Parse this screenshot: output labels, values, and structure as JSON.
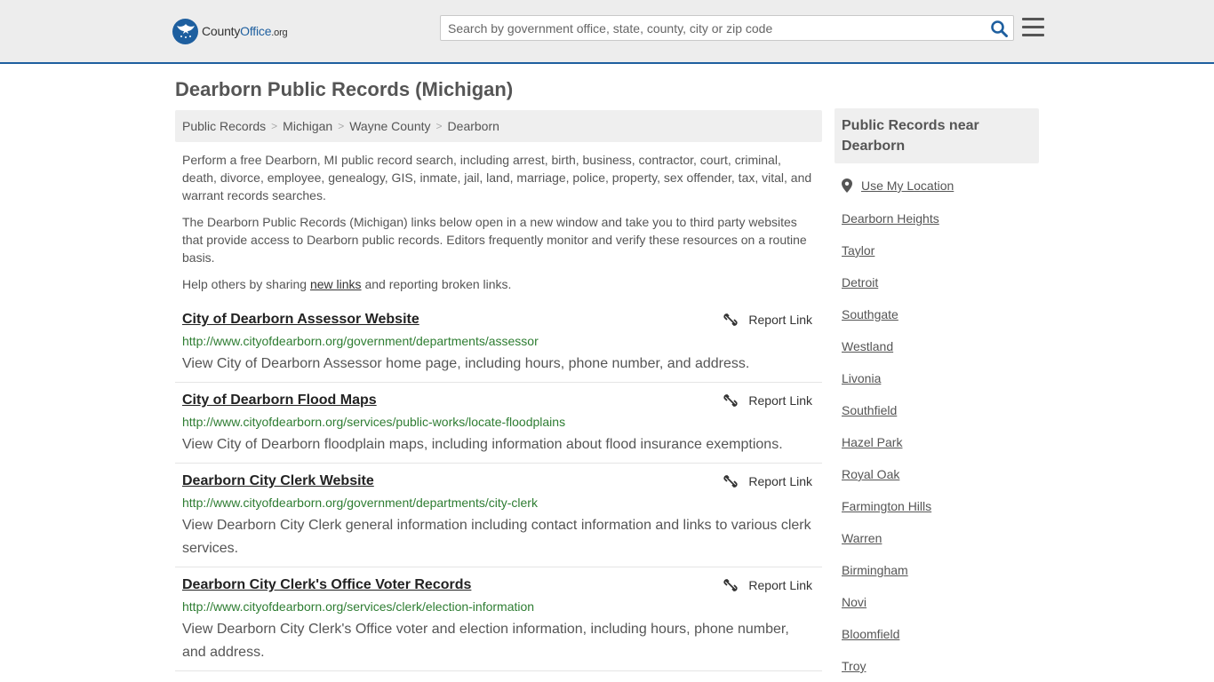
{
  "header": {
    "logo": {
      "brand": "County",
      "brand2": "Office",
      "tld": ".org"
    },
    "search": {
      "placeholder": "Search by government office, state, county, city or zip code"
    }
  },
  "page": {
    "title": "Dearborn Public Records (Michigan)",
    "breadcrumb": [
      "Public Records",
      "Michigan",
      "Wayne County",
      "Dearborn"
    ],
    "intro1": "Perform a free Dearborn, MI public record search, including arrest, birth, business, contractor, court, criminal, death, divorce, employee, genealogy, GIS, inmate, jail, land, marriage, police, property, sex offender, tax, vital, and warrant records searches.",
    "intro2": "The Dearborn Public Records (Michigan) links below open in a new window and take you to third party websites that provide access to Dearborn public records. Editors frequently monitor and verify these resources on a routine basis.",
    "help_pre": "Help others by sharing ",
    "help_link": "new links",
    "help_post": " and reporting broken links."
  },
  "report_label": "Report Link",
  "results": [
    {
      "title": "City of Dearborn Assessor Website",
      "url": "http://www.cityofdearborn.org/government/departments/assessor",
      "desc": "View City of Dearborn Assessor home page, including hours, phone number, and address."
    },
    {
      "title": "City of Dearborn Flood Maps",
      "url": "http://www.cityofdearborn.org/services/public-works/locate-floodplains",
      "desc": "View City of Dearborn floodplain maps, including information about flood insurance exemptions."
    },
    {
      "title": "Dearborn City Clerk Website",
      "url": "http://www.cityofdearborn.org/government/departments/city-clerk",
      "desc": "View Dearborn City Clerk general information including contact information and links to various clerk services."
    },
    {
      "title": "Dearborn City Clerk's Office Voter Records",
      "url": "http://www.cityofdearborn.org/services/clerk/election-information",
      "desc": "View Dearborn City Clerk's Office voter and election information, including hours, phone number, and address."
    }
  ],
  "sidebar": {
    "heading": "Public Records near Dearborn",
    "use_location": "Use My Location",
    "cities": [
      "Dearborn Heights",
      "Taylor",
      "Detroit",
      "Southgate",
      "Westland",
      "Livonia",
      "Southfield",
      "Hazel Park",
      "Royal Oak",
      "Farmington Hills",
      "Warren",
      "Birmingham",
      "Novi",
      "Bloomfield",
      "Troy"
    ]
  },
  "colors": {
    "accent": "#1e5f9f",
    "url_green": "#2e7d32",
    "header_bg": "#ededed"
  }
}
